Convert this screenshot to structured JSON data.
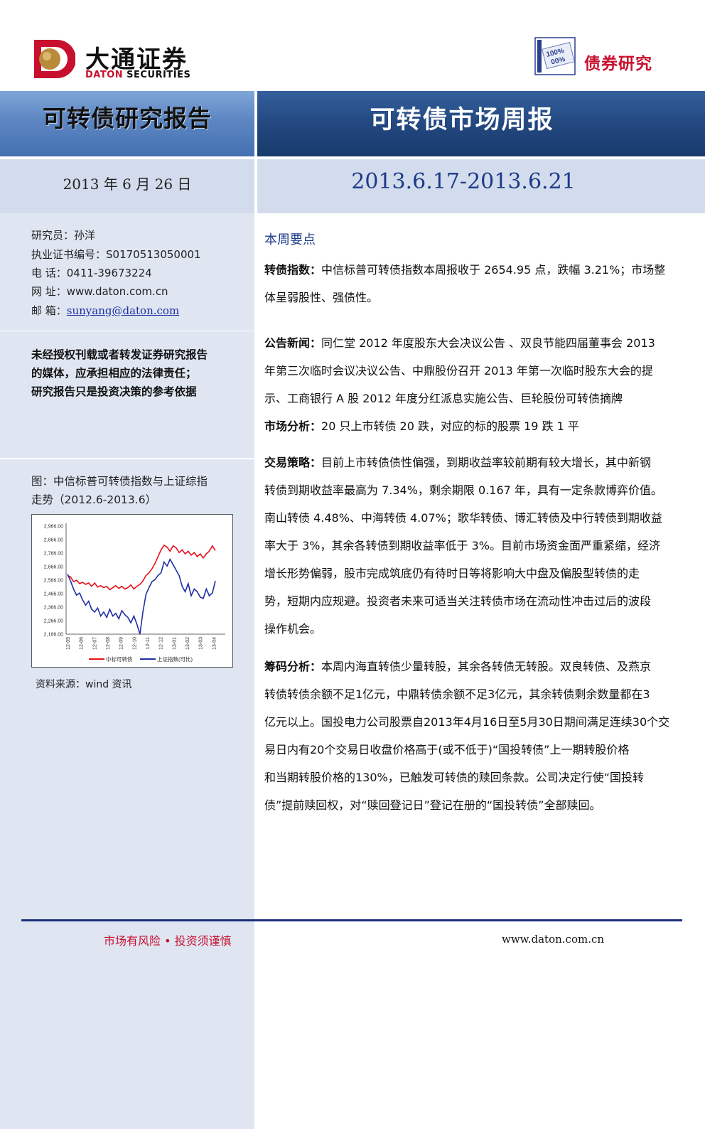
{
  "header": {
    "brand_cn": "大通证券",
    "brand_en_a": "DATON",
    "brand_en_b": " SECURITIES",
    "bond_badge_text_1": "100%",
    "bond_badge_text_2": "00%",
    "bond_label": "债券研究",
    "report_type": "可转债研究报告",
    "report_name": "可转债市场周报",
    "report_date": "2013 年 6 月 26 日",
    "period": "2013.6.17-2013.6.21"
  },
  "sidebar": {
    "analyst": "研究员：孙洋",
    "cert": "执业证书编号：S0170513050001",
    "phone": "电    话：0411-39673224",
    "web": "网    址：www.daton.com.cn",
    "email_label": "邮    箱：",
    "email": "sunyang@daton.com",
    "warning": [
      "未经授权刊载或者转发证券研究报告",
      "的媒体，应承担相应的法律责任；",
      "研究报告只是投资决策的参考依据"
    ],
    "figure_caption": [
      "图：中信标普可转债指数与上证综指",
      "走势（2012.6-2013.6）"
    ],
    "source": "资料来源：wind 资讯"
  },
  "chart_data": {
    "type": "line",
    "title": "",
    "xlabel": "",
    "ylabel": "",
    "ylim": [
      2166,
      2966
    ],
    "yticks": [
      "2,966.00",
      "2,866.00",
      "2,766.00",
      "2,666.00",
      "2,566.00",
      "2,466.00",
      "2,366.00",
      "2,266.00",
      "2,166.00"
    ],
    "xticks": [
      "12-05",
      "12-06",
      "12-07",
      "12-08",
      "12-09",
      "12-10",
      "12-11",
      "12-12",
      "13-01",
      "13-02",
      "13-03",
      "13-04"
    ],
    "legend_position": "bottom",
    "series": [
      {
        "name": "中标可转债",
        "color": "#e8101a",
        "values": [
          2600,
          2590,
          2555,
          2565,
          2540,
          2550,
          2535,
          2545,
          2520,
          2545,
          2515,
          2525,
          2510,
          2520,
          2495,
          2510,
          2525,
          2505,
          2520,
          2500,
          2510,
          2530,
          2500,
          2520,
          2535,
          2560,
          2600,
          2620,
          2650,
          2690,
          2740,
          2790,
          2825,
          2810,
          2780,
          2820,
          2805,
          2770,
          2790,
          2760,
          2780,
          2750,
          2770,
          2740,
          2760,
          2730,
          2760,
          2780,
          2820,
          2785
        ]
      },
      {
        "name": "上证指数(可比)",
        "color": "#1f2ea5",
        "values": [
          2610,
          2560,
          2500,
          2455,
          2470,
          2420,
          2380,
          2410,
          2350,
          2330,
          2360,
          2300,
          2330,
          2290,
          2350,
          2300,
          2320,
          2280,
          2340,
          2310,
          2290,
          2250,
          2300,
          2240,
          2166,
          2330,
          2460,
          2510,
          2555,
          2570,
          2600,
          2620,
          2700,
          2670,
          2720,
          2680,
          2640,
          2600,
          2520,
          2480,
          2540,
          2450,
          2500,
          2480,
          2440,
          2430,
          2500,
          2450,
          2470,
          2560
        ]
      }
    ]
  },
  "main": {
    "summary_title": "本周要点",
    "sections": [
      {
        "label": "转债指数：",
        "lines": [
          "中信标普可转债指数本周报收于 2654.95 点，跌幅 3.21%；市场整",
          "体呈弱股性、强债性。"
        ]
      },
      {
        "label": "公告新闻：",
        "lines": [
          "同仁堂 2012 年度股东大会决议公告 、双良节能四届董事会 2013",
          "年第三次临时会议决议公告、中鼎股份召开 2013 年第一次临时股东大会的提",
          "示、工商银行 A 股 2012 年度分红派息实施公告、巨轮股份可转债摘牌"
        ]
      },
      {
        "label": "市场分析：",
        "lines": [
          "20 只上市转债 20 跌，对应的标的股票 19 跌 1 平"
        ]
      },
      {
        "label": "交易策略：",
        "lines": [
          "目前上市转债债性偏强，到期收益率较前期有较大增长，其中新钢",
          "转债到期收益率最高为 7.34%，剩余期限 0.167 年，具有一定条款博弈价值。",
          "南山转债 4.48%、中海转债 4.07%；歌华转债、博汇转债及中行转债到期收益",
          "率大于 3%，其余各转债到期收益率低于 3%。目前市场资金面严重紧缩，经济",
          "增长形势偏弱，股市完成筑底仍有待时日等将影响大中盘及偏股型转债的走",
          "势，短期内应规避。投资者未来可适当关注转债市场在流动性冲击过后的波段",
          "操作机会。"
        ]
      },
      {
        "label": "筹码分析：",
        "lines": [
          "本周内海直转债少量转股，其余各转债无转股。双良转债、及燕京",
          "转债转债余额不足1亿元，中鼎转债余额不足3亿元，其余转债剩余数量都在3",
          "亿元以上。国投电力公司股票自2013年4月16日至5月30日期间满足连续30个交",
          "易日内有20个交易日收盘价格高于(或不低于)“国投转债”上一期转股价格",
          "和当期转股价格的130%，已触发可转债的赎回条款。公司决定行使“国投转",
          "债”提前赎回权，对“赎回登记日”登记在册的“国投转债”全部赎回。"
        ]
      }
    ]
  },
  "footer": {
    "slogan": "市场有风险 • 投资须谨慎",
    "site": "www.daton.com.cn"
  }
}
